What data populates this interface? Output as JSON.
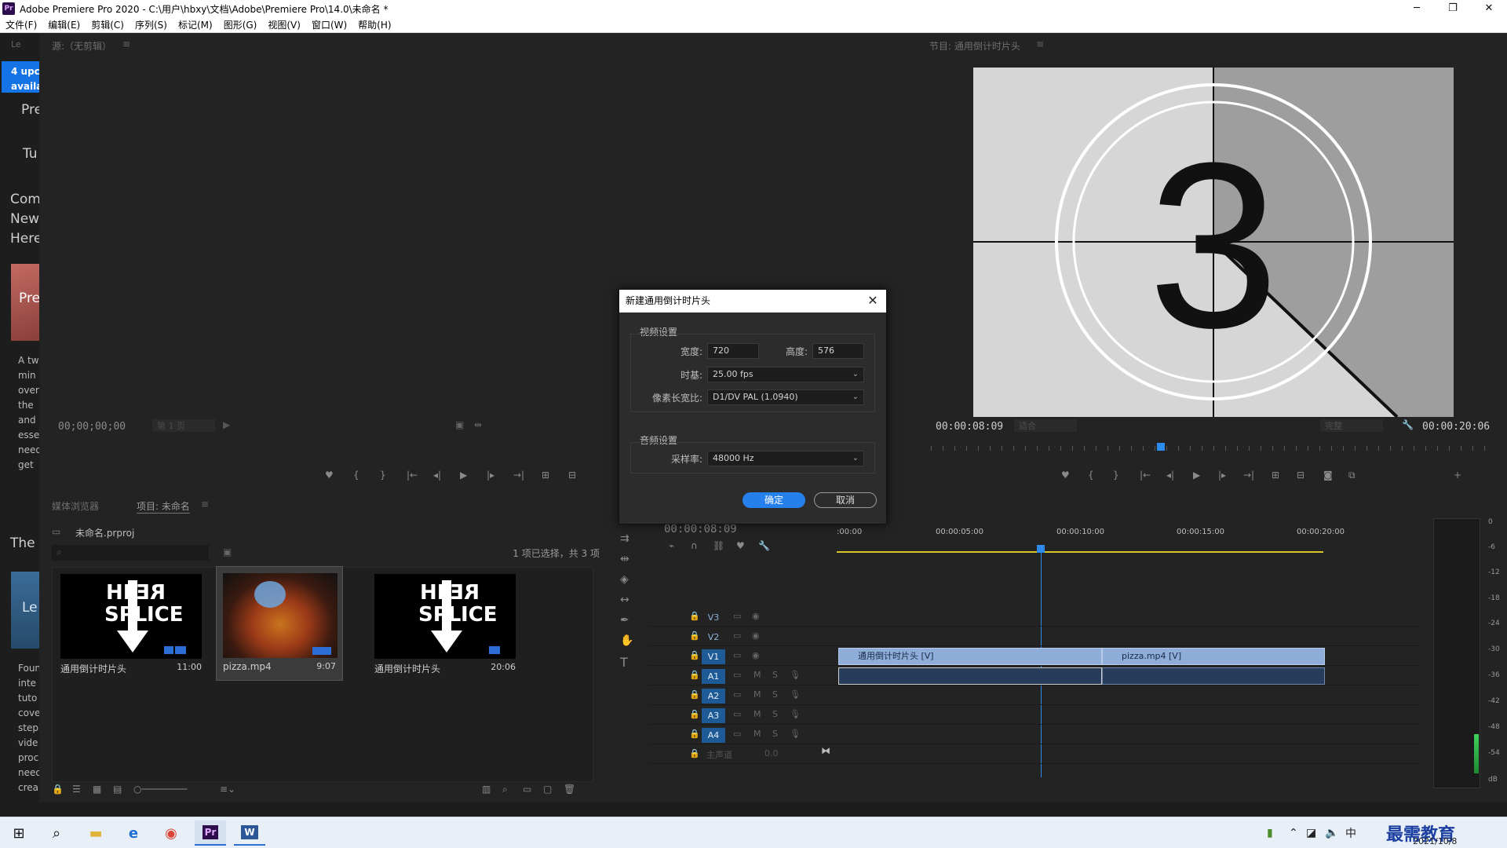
{
  "window": {
    "title": "Adobe Premiere Pro 2020 - C:\\用户\\hbxy\\文档\\Adobe\\Premiere Pro\\14.0\\未命名 *",
    "logo": "Pr",
    "controls": [
      "─",
      "❐",
      "✕"
    ]
  },
  "menu": [
    "文件(F)",
    "编辑(E)",
    "剪辑(C)",
    "序列(S)",
    "标记(M)",
    "图形(G)",
    "视图(V)",
    "窗口(W)",
    "帮助(H)"
  ],
  "learn_panel": {
    "tab": "Le",
    "update_line1": "4 upc",
    "update_line2": "availa",
    "items": [
      "Pre",
      "Tu",
      "Com",
      "New",
      "Here",
      "Pre",
      "The",
      "Le"
    ],
    "para1": [
      "A tw",
      "min",
      "over",
      "the",
      "and",
      "esse",
      "need",
      "get"
    ],
    "para2": [
      "Foun",
      "inte",
      "tuto",
      "cove",
      "step",
      "vide",
      "proc",
      "need",
      "crea"
    ]
  },
  "source_monitor": {
    "tab": "源:（无剪辑）",
    "timecode": "00;00;00;00",
    "page": "第 1 页"
  },
  "program_monitor": {
    "tab": "节目: 通用倒计时片头",
    "timecode": "00:00:08:09",
    "fit": "适合",
    "quality": "完整",
    "duration": "00:00:20:06",
    "countdown_number": "3"
  },
  "project_panel": {
    "tabs": [
      "媒体浏览器",
      "项目: 未命名"
    ],
    "project_file": "未命名.prproj",
    "selection_status": "1 项已选择，共 3 项",
    "clips": [
      {
        "name": "通用倒计时片头",
        "duration": "11:00",
        "thumb": "HERE SPLICE",
        "selected": false
      },
      {
        "name": "pizza.mp4",
        "duration": "9:07",
        "thumb": "pizza",
        "selected": true
      },
      {
        "name": "通用倒计时片头",
        "duration": "20:06",
        "thumb": "HERE SPLICE",
        "selected": false
      }
    ]
  },
  "timeline": {
    "timecode": "00:00:08:09",
    "ruler": [
      ":00:00",
      "00:00:05:00",
      "00:00:10:00",
      "00:00:15:00",
      "00:00:20:00"
    ],
    "tracks": [
      "V3",
      "V2",
      "V1",
      "A1",
      "A2",
      "A3",
      "A4"
    ],
    "master_label": "主声道",
    "master_value": "0.0",
    "clips": {
      "v1_a": "通用倒计时片头 [V]",
      "v1_b": "pizza.mp4 [V]"
    }
  },
  "meter": {
    "scale": [
      "0",
      "-6",
      "-12",
      "-18",
      "-24",
      "-30",
      "-36",
      "-42",
      "-48",
      "-54",
      "dB"
    ]
  },
  "dialog": {
    "title": "新建通用倒计时片头",
    "video_group": "视频设置",
    "width_label": "宽度:",
    "width_value": "720",
    "height_label": "高度:",
    "height_value": "576",
    "timebase_label": "时基:",
    "timebase_value": "25.00 fps",
    "par_label": "像素长宽比:",
    "par_value": "D1/DV PAL (1.0940)",
    "audio_group": "音频设置",
    "samplerate_label": "采样率:",
    "samplerate_value": "48000 Hz",
    "ok": "确定",
    "cancel": "取消"
  },
  "taskbar": {
    "date": "2021/10/8",
    "watermark": "最需教育",
    "ime": "中",
    "apps": [
      "windows-start",
      "search",
      "file-explorer",
      "edge",
      "chrome",
      "premiere",
      "word"
    ]
  },
  "colors": {
    "accent": "#2680eb",
    "playhead": "#2d8ceb",
    "video_clip": "#8eaed9",
    "track_on": "#1e5a96"
  }
}
